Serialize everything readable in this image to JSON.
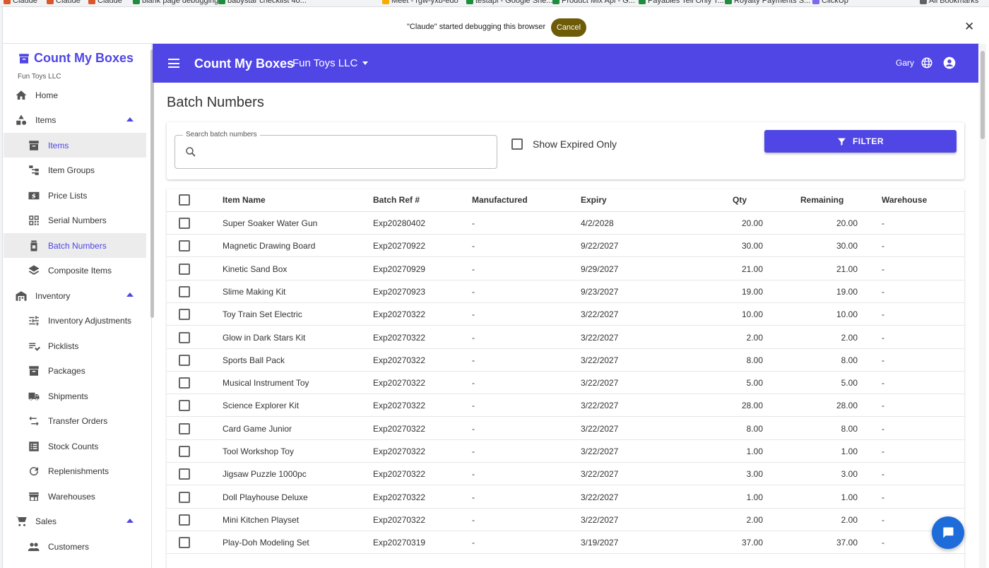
{
  "browser": {
    "bookmarks": [
      {
        "label": "Claude",
        "color": "#d9572b"
      },
      {
        "label": "Claude",
        "color": "#d9572b"
      },
      {
        "label": "Claude",
        "color": "#d9572b"
      },
      {
        "label": "blank page debugging",
        "color": "#1e8e3e"
      },
      {
        "label": "babystar checklist 4o...",
        "color": "#1e8e3e"
      },
      {
        "label": "Meet - rgw-yxb-edo",
        "color": "#f9ab00"
      },
      {
        "label": "testapi - Google She...",
        "color": "#1e8e3e"
      },
      {
        "label": "Product Mix Api - G...",
        "color": "#1e8e3e"
      },
      {
        "label": "Payables Tell Only T...",
        "color": "#1e8e3e"
      },
      {
        "label": "Royalty Payments S...",
        "color": "#1e8e3e"
      },
      {
        "label": "ClickUp",
        "color": "#7b68ee"
      },
      {
        "label": "All Bookmarks",
        "color": "#5f6368"
      }
    ],
    "debug_banner": {
      "message": "\"Claude\" started debugging this browser",
      "cancel_label": "Cancel",
      "close_glyph": "✕"
    }
  },
  "sidebar": {
    "brand_name": "Count My Boxes",
    "company": "Fun Toys LLC",
    "items": [
      {
        "label": "Home",
        "icon": "home-icon",
        "level": "top",
        "active": false
      },
      {
        "label": "Items",
        "icon": "shapes-icon",
        "level": "top",
        "active": false,
        "expanded": true
      },
      {
        "label": "Items",
        "icon": "archive-icon",
        "level": "sub",
        "active": true
      },
      {
        "label": "Item Groups",
        "icon": "group-icon",
        "level": "sub",
        "active": false
      },
      {
        "label": "Price Lists",
        "icon": "price-icon",
        "level": "sub",
        "active": false
      },
      {
        "label": "Serial Numbers",
        "icon": "qr-icon",
        "level": "sub",
        "active": false
      },
      {
        "label": "Batch Numbers",
        "icon": "jar-icon",
        "level": "sub",
        "active": true
      },
      {
        "label": "Composite Items",
        "icon": "layers-icon",
        "level": "sub",
        "active": false
      },
      {
        "label": "Inventory",
        "icon": "warehouse-icon",
        "level": "top",
        "active": false,
        "expanded": true
      },
      {
        "label": "Inventory Adjustments",
        "icon": "tune-icon",
        "level": "sub",
        "active": false
      },
      {
        "label": "Picklists",
        "icon": "checklist-icon",
        "level": "sub",
        "active": false
      },
      {
        "label": "Packages",
        "icon": "package-icon",
        "level": "sub",
        "active": false
      },
      {
        "label": "Shipments",
        "icon": "truck-icon",
        "level": "sub",
        "active": false
      },
      {
        "label": "Transfer Orders",
        "icon": "swap-icon",
        "level": "sub",
        "active": false
      },
      {
        "label": "Stock Counts",
        "icon": "checkbox-list-icon",
        "level": "sub",
        "active": false
      },
      {
        "label": "Replenishments",
        "icon": "refresh-icon",
        "level": "sub",
        "active": false
      },
      {
        "label": "Warehouses",
        "icon": "store-icon",
        "level": "sub",
        "active": false
      },
      {
        "label": "Sales",
        "icon": "cart-icon",
        "level": "top",
        "active": false,
        "expanded": true
      },
      {
        "label": "Customers",
        "icon": "people-icon",
        "level": "sub",
        "active": false
      }
    ]
  },
  "appbar": {
    "title": "Count My Boxes",
    "company_select": "Fun Toys LLC",
    "user": "Gary"
  },
  "main": {
    "title": "Batch Numbers",
    "search": {
      "label": "Search batch numbers",
      "value": "",
      "placeholder": ""
    },
    "show_expired_label": "Show Expired Only",
    "filter_label": "FILTER",
    "table": {
      "headers": {
        "name": "Item Name",
        "batch": "Batch Ref #",
        "mfg": "Manufactured",
        "exp": "Expiry",
        "qty": "Qty",
        "rem": "Remaining",
        "wh": "Warehouse"
      },
      "rows": [
        {
          "name": "Super Soaker Water Gun",
          "batch": "Exp20280402",
          "mfg": "-",
          "exp": "4/2/2028",
          "qty": "20.00",
          "rem": "20.00",
          "wh": "-"
        },
        {
          "name": "Magnetic Drawing Board",
          "batch": "Exp20270922",
          "mfg": "-",
          "exp": "9/22/2027",
          "qty": "30.00",
          "rem": "30.00",
          "wh": "-"
        },
        {
          "name": "Kinetic Sand Box",
          "batch": "Exp20270929",
          "mfg": "-",
          "exp": "9/29/2027",
          "qty": "21.00",
          "rem": "21.00",
          "wh": "-"
        },
        {
          "name": "Slime Making Kit",
          "batch": "Exp20270923",
          "mfg": "-",
          "exp": "9/23/2027",
          "qty": "19.00",
          "rem": "19.00",
          "wh": "-"
        },
        {
          "name": "Toy Train Set Electric",
          "batch": "Exp20270322",
          "mfg": "-",
          "exp": "3/22/2027",
          "qty": "10.00",
          "rem": "10.00",
          "wh": "-"
        },
        {
          "name": "Glow in Dark Stars Kit",
          "batch": "Exp20270322",
          "mfg": "-",
          "exp": "3/22/2027",
          "qty": "2.00",
          "rem": "2.00",
          "wh": "-"
        },
        {
          "name": "Sports Ball Pack",
          "batch": "Exp20270322",
          "mfg": "-",
          "exp": "3/22/2027",
          "qty": "8.00",
          "rem": "8.00",
          "wh": "-"
        },
        {
          "name": "Musical Instrument Toy",
          "batch": "Exp20270322",
          "mfg": "-",
          "exp": "3/22/2027",
          "qty": "5.00",
          "rem": "5.00",
          "wh": "-"
        },
        {
          "name": "Science Explorer Kit",
          "batch": "Exp20270322",
          "mfg": "-",
          "exp": "3/22/2027",
          "qty": "28.00",
          "rem": "28.00",
          "wh": "-"
        },
        {
          "name": "Card Game Junior",
          "batch": "Exp20270322",
          "mfg": "-",
          "exp": "3/22/2027",
          "qty": "8.00",
          "rem": "8.00",
          "wh": "-"
        },
        {
          "name": "Tool Workshop Toy",
          "batch": "Exp20270322",
          "mfg": "-",
          "exp": "3/22/2027",
          "qty": "1.00",
          "rem": "1.00",
          "wh": "-"
        },
        {
          "name": "Jigsaw Puzzle 1000pc",
          "batch": "Exp20270322",
          "mfg": "-",
          "exp": "3/22/2027",
          "qty": "3.00",
          "rem": "3.00",
          "wh": "-"
        },
        {
          "name": "Doll Playhouse Deluxe",
          "batch": "Exp20270322",
          "mfg": "-",
          "exp": "3/22/2027",
          "qty": "1.00",
          "rem": "1.00",
          "wh": "-"
        },
        {
          "name": "Mini Kitchen Playset",
          "batch": "Exp20270322",
          "mfg": "-",
          "exp": "3/22/2027",
          "qty": "2.00",
          "rem": "2.00",
          "wh": "-"
        },
        {
          "name": "Play-Doh Modeling Set",
          "batch": "Exp20270319",
          "mfg": "-",
          "exp": "3/19/2027",
          "qty": "37.00",
          "rem": "37.00",
          "wh": "-"
        }
      ]
    }
  },
  "colors": {
    "primary": "#5046e5",
    "cancel_button": "#6e5b08",
    "chat_fab": "#1d6cd9"
  },
  "chat_icon": "chat-bubble-icon"
}
